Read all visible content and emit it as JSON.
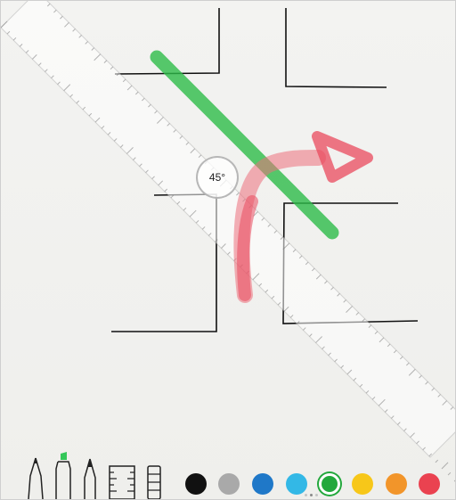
{
  "protractor": {
    "angle": "45°"
  },
  "toolbar": {
    "tools": [
      {
        "name": "pen",
        "icon": "pen-icon"
      },
      {
        "name": "marker",
        "icon": "marker-icon",
        "tip_color": "#34c759"
      },
      {
        "name": "pencil",
        "icon": "pencil-icon"
      },
      {
        "name": "ruler",
        "icon": "ruler-icon"
      },
      {
        "name": "eraser",
        "icon": "eraser-icon"
      }
    ],
    "colors": [
      {
        "name": "black",
        "hex": "#111111",
        "selected": false
      },
      {
        "name": "gray",
        "hex": "#a9a9a9",
        "selected": false
      },
      {
        "name": "blue",
        "hex": "#1f78c8",
        "selected": false
      },
      {
        "name": "light-blue",
        "hex": "#33b8e6",
        "selected": false
      },
      {
        "name": "green",
        "hex": "#22a83c",
        "selected": true
      },
      {
        "name": "yellow",
        "hex": "#f7c719",
        "selected": false
      },
      {
        "name": "orange",
        "hex": "#f2952a",
        "selected": false
      },
      {
        "name": "red",
        "hex": "#ea4250",
        "selected": false
      }
    ]
  },
  "page_indicator": {
    "count": 3,
    "active": 1
  }
}
